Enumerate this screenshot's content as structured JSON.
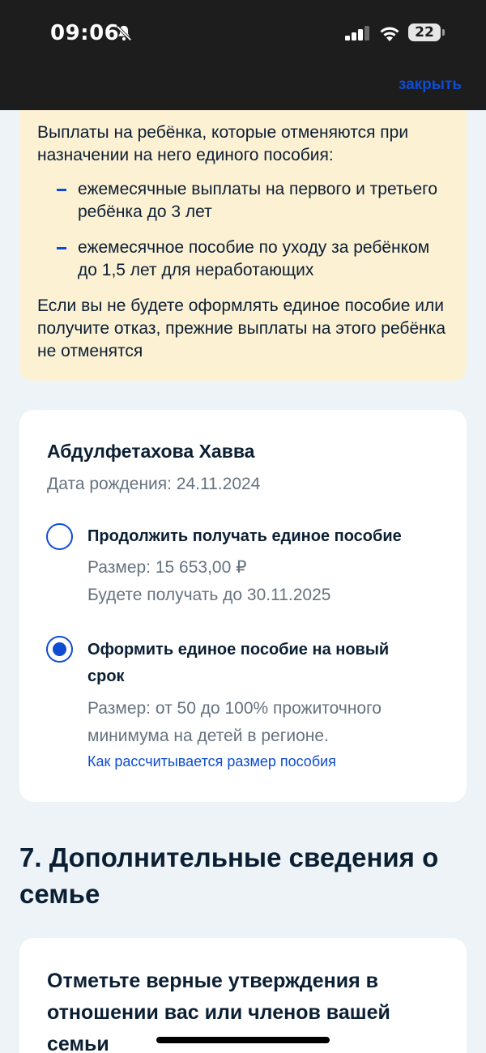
{
  "status_bar": {
    "time": "09:06",
    "battery": "22",
    "icons": [
      "bell-off-icon",
      "signal-icon",
      "wifi-icon",
      "battery-icon"
    ]
  },
  "header": {
    "close_label": "закрыть"
  },
  "info": {
    "intro": "Выплаты на ребёнка, которые отменяются при назначении на него единого пособия:",
    "bullets": [
      "ежемесячные выплаты на первого и третьего ребёнка до 3 лет",
      "ежемесячное пособие по уходу за ребёнком до 1,5 лет для неработающих"
    ],
    "footer": "Если вы не будете оформлять единое пособие или получите отказ, прежние выплаты на этого ребёнка не отменятся"
  },
  "child": {
    "name": "Абдулфетахова Хавва",
    "dob": "Дата рождения: 24.11.2024",
    "options": [
      {
        "title": "Продолжить получать единое пособие",
        "size": "Размер: 15 653,00 ₽",
        "until": "Будете получать до 30.11.2025",
        "selected": false
      },
      {
        "title": "Оформить единое пособие на новый срок",
        "size": "Размер: от 50 до 100% прожиточного минимума на детей в регионе.",
        "link": "Как рассчитывается размер пособия",
        "selected": true
      }
    ]
  },
  "section": {
    "title": "7. Дополнительные сведения о семье"
  },
  "question": {
    "title": "Отметьте верные утверждения в отношении вас или членов вашей семьи"
  },
  "colors": {
    "accent": "#0d4cd3",
    "info_bg": "#fdf1d4",
    "page_bg": "#eef3f8",
    "text": "#0b1f33",
    "muted": "#66727f"
  }
}
